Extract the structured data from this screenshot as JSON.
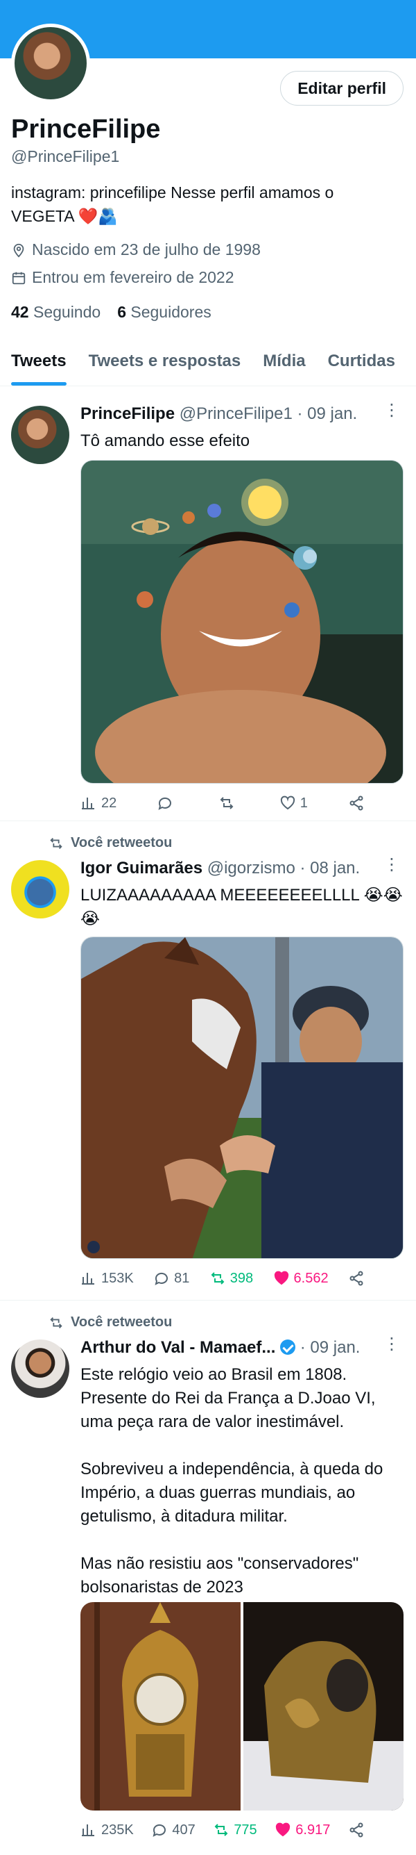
{
  "profile": {
    "edit_label": "Editar perfil",
    "name": "PrinceFilipe",
    "handle": "@PrinceFilipe1",
    "bio": "instagram: princefilipe Nesse perfil amamos o VEGETA ❤️🫂",
    "birth": "Nascido em 23 de julho de 1998",
    "joined": "Entrou em fevereiro de 2022",
    "following_count": "42",
    "following_label": "Seguindo",
    "followers_count": "6",
    "followers_label": "Seguidores"
  },
  "tabs": [
    "Tweets",
    "Tweets e respostas",
    "Mídia",
    "Curtidas"
  ],
  "tweets": [
    {
      "name": "PrinceFilipe",
      "handle": "@PrinceFilipe1",
      "date": "· 09 jan.",
      "text": "Tô amando esse efeito",
      "views": "22",
      "replies": "",
      "retweets": "",
      "likes": "1"
    },
    {
      "retweet_label": "Você retweetou",
      "name": "Igor Guimarães",
      "handle": "@igorzismo",
      "date": "· 08 jan.",
      "text": "LUIZAAAAAAAAA MEEEEEEEELLLL 😭😭😭",
      "views": "153K",
      "replies": "81",
      "retweets": "398",
      "likes": "6.562"
    },
    {
      "retweet_label": "Você retweetou",
      "name": "Arthur do Val - Mamaef...",
      "handle": "",
      "date": "· 09 jan.",
      "text": "Este relógio veio ao Brasil em 1808. Presente do Rei da França a D.Joao VI, uma peça rara de valor inestimável.\n\nSobreviveu a independência, à queda do Império, a duas guerras mundiais, ao getulismo, à ditadura militar.\n\nMas não resistiu aos \"conservadores\" bolsonaristas de 2023",
      "views": "235K",
      "replies": "407",
      "retweets": "775",
      "likes": "6.917"
    }
  ],
  "icons": {
    "location": "location-pin-icon",
    "calendar": "calendar-icon",
    "views": "bar-chart-icon",
    "reply": "speech-bubble-icon",
    "retweet": "retweet-icon",
    "like": "heart-icon",
    "share": "share-icon"
  },
  "colors": {
    "accent": "#1d9bf0",
    "retweet": "#00ba7c",
    "like": "#f91880"
  }
}
